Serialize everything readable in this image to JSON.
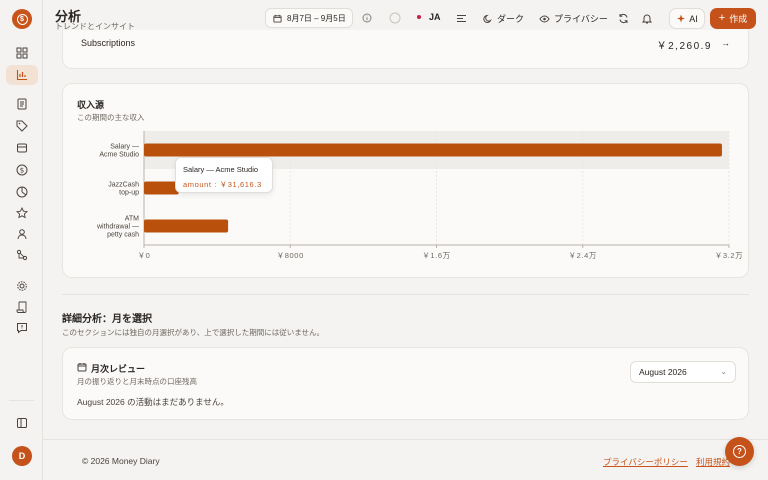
{
  "header": {
    "title": "分析",
    "subtitle": "トレンドとインサイト",
    "date_range": "8月7日 – 9月5日",
    "language": "JA",
    "theme_label": "ダーク",
    "privacy_label": "プライバシー",
    "ai_label": "AI",
    "create_label": "作成"
  },
  "sidebar": {
    "logo": "$",
    "avatar": "D",
    "items": [
      {
        "icon": "dashboard-icon"
      },
      {
        "icon": "analytics-icon",
        "active": true
      },
      {
        "icon": "document-icon"
      },
      {
        "icon": "tag-icon"
      },
      {
        "icon": "archive-icon"
      },
      {
        "icon": "dollar-icon"
      },
      {
        "icon": "pie-icon"
      },
      {
        "icon": "star-icon"
      },
      {
        "icon": "user-icon"
      },
      {
        "icon": "sprout-icon"
      },
      {
        "icon": "gear-icon"
      },
      {
        "icon": "scroll-icon"
      },
      {
        "icon": "message-icon"
      },
      {
        "icon": "sidebar-toggle-icon"
      }
    ]
  },
  "subscriptions": {
    "label": "Subscriptions",
    "value": "￥2,260.9",
    "arrow": "→"
  },
  "income": {
    "title": "収入源",
    "subtitle": "この期間の主な収入",
    "tooltip": {
      "title": "Salary — Acme Studio",
      "value": "amount : ￥31,616.3"
    }
  },
  "chart_data": {
    "type": "bar",
    "orientation": "horizontal",
    "categories": [
      "Salary — Acme Studio",
      "JazzCash top-up",
      "ATM withdrawal — petty cash"
    ],
    "category_lines": [
      [
        "Salary —",
        "Acme Studio"
      ],
      [
        "JazzCash",
        "top-up"
      ],
      [
        "ATM",
        "withdrawal —",
        "petty cash"
      ]
    ],
    "values": [
      31616.3,
      1900,
      4600
    ],
    "xlim": [
      0,
      32000
    ],
    "ticks": [
      0,
      8000,
      16000,
      24000,
      32000
    ],
    "tick_labels": [
      "￥0",
      "￥8000",
      "￥1.6万",
      "￥2.4万",
      "￥3.2万"
    ],
    "bar_color": "#b9510d",
    "grid": true
  },
  "detail": {
    "title": "詳細分析：月を選択",
    "subtitle": "このセクションには独自の月選択があり、上で選択した期間には従いません。"
  },
  "monthly": {
    "title": "月次レビュー",
    "subtitle": "月の振り返りと月末時点の口座残高",
    "selected_month": "August 2026",
    "empty_text": "August 2026 の活動はまだありません。"
  },
  "footer": {
    "copyright": "© 2026 Money Diary",
    "privacy_link": "プライバシーポリシー",
    "terms_link": "利用規約"
  },
  "colors": {
    "accent": "#c4521a",
    "background": "#f4f3f1",
    "card": "#fbfaf8"
  }
}
